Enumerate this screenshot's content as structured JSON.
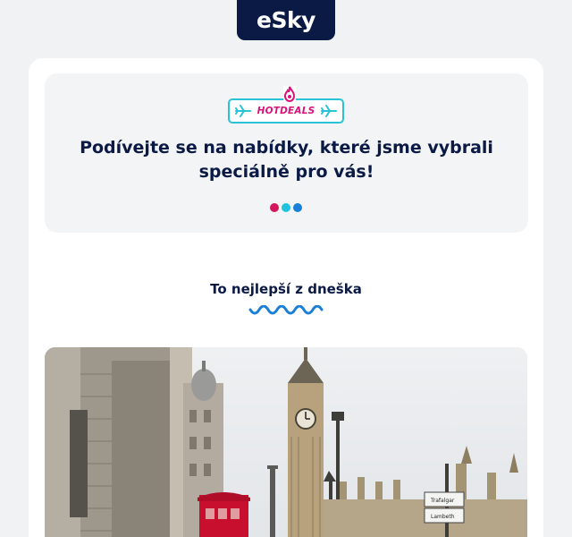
{
  "logo": {
    "text": "eSky",
    "icon": "esky-logo"
  },
  "hero": {
    "badge_label": "HOTDEALS",
    "badge_icons": [
      "flame-icon",
      "plane-icon"
    ],
    "title_line1": "Podívejte se na nabídky, které jsme vybrali",
    "title_line2": "speciálně pro vás!",
    "dots_colors": [
      "#d6165c",
      "#1fc3e0",
      "#1a7fd6"
    ]
  },
  "section": {
    "title": "To nejlepší z dneška"
  },
  "photo": {
    "description_icon": "london-photo",
    "sign_texts": [
      "Trafalgar Square",
      "Lambeth Bridge"
    ]
  },
  "colors": {
    "navy": "#0b1a45",
    "pink": "#d8137a",
    "cyan": "#29c3d6",
    "blue": "#1a7fd6"
  }
}
